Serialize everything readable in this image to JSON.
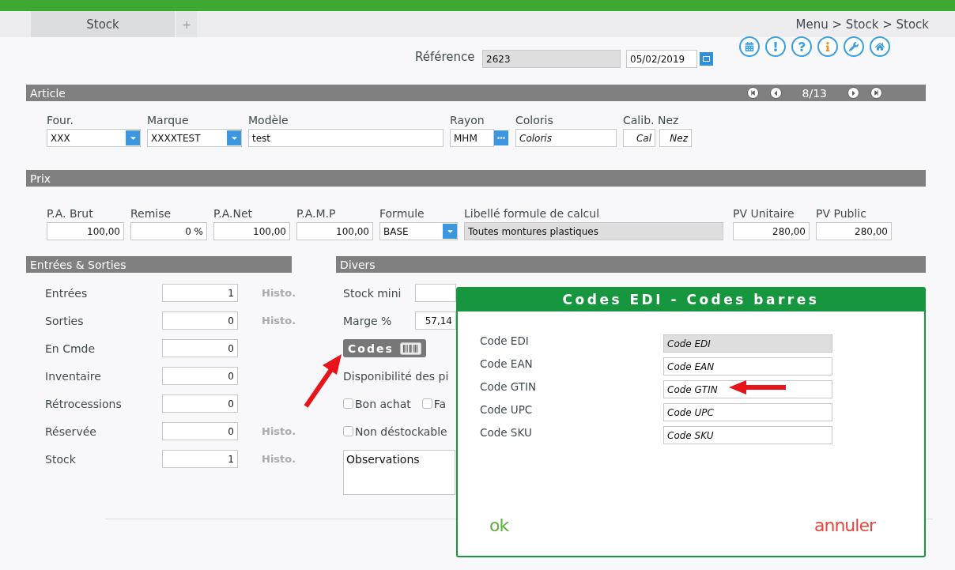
{
  "tabs": [
    {
      "label": "Stock",
      "selected": true
    },
    {
      "label": "+",
      "selected": false
    }
  ],
  "breadcrumb": "Menu > Stock > Stock",
  "reference": {
    "label": "Référence",
    "value": "2623",
    "date": "05/02/2019"
  },
  "toolbar_icons": [
    {
      "kind": "calendar"
    },
    {
      "kind": "alert"
    },
    {
      "kind": "help"
    },
    {
      "kind": "info"
    },
    {
      "kind": "tools"
    },
    {
      "kind": "home"
    }
  ],
  "article": {
    "title": "Article",
    "pager": "8/13",
    "fields": [
      {
        "kind": "select",
        "label": "Four.",
        "value": "XXX"
      },
      {
        "kind": "select",
        "label": "Marque",
        "value": "XXXXTEST"
      },
      {
        "kind": "text",
        "label": "Modèle",
        "value": "test"
      },
      {
        "kind": "lookup",
        "label": "Rayon",
        "value": "MHM"
      },
      {
        "kind": "text",
        "label": "Coloris",
        "placeholder": "Coloris"
      },
      {
        "kind": "pair",
        "label": "Calib. Nez",
        "placeholders": [
          "Cal",
          "Nez"
        ]
      }
    ]
  },
  "prix": {
    "title": "Prix",
    "fields": [
      {
        "kind": "number",
        "label": "P.A. Brut",
        "value": "100,00"
      },
      {
        "kind": "number",
        "label": "Remise",
        "value": "0 %"
      },
      {
        "kind": "number",
        "label": "P.A.Net",
        "value": "100,00"
      },
      {
        "kind": "number",
        "label": "P.A.M.P",
        "value": "100,00"
      },
      {
        "kind": "select",
        "label": "Formule",
        "value": "BASE"
      },
      {
        "kind": "readonly",
        "label": "Libellé formule de calcul",
        "value": "Toutes montures plastiques"
      },
      {
        "kind": "number",
        "label": "PV Unitaire",
        "value": "280,00"
      },
      {
        "kind": "number",
        "label": "PV Public",
        "value": "280,00"
      }
    ]
  },
  "entrees_sorties": {
    "title": "Entrées & Sorties",
    "rows": [
      {
        "label": "Entrées",
        "value": "1",
        "histo": "Histo."
      },
      {
        "label": "Sorties",
        "value": "0",
        "histo": "Histo."
      },
      {
        "label": "En Cmde",
        "value": "0"
      },
      {
        "label": "Inventaire",
        "value": "0"
      },
      {
        "label": "Rétrocessions",
        "value": "0"
      },
      {
        "label": "Réservée",
        "value": "0",
        "histo": "Histo."
      },
      {
        "label": "Stock",
        "value": "1",
        "histo": "Histo."
      }
    ]
  },
  "divers": {
    "title": "Divers",
    "stock_mini": {
      "label": "Stock mini"
    },
    "marge": {
      "label": "Marge %",
      "value": "57,14"
    },
    "codes_button": "Codes",
    "availability": "Disponibilité des pi",
    "checkbox_rows": [
      {
        "items": [
          {
            "label": "Bon achat",
            "checked": false
          },
          {
            "label": "Fa",
            "checked": false
          }
        ]
      },
      {
        "items": [
          {
            "label": "Non déstockable",
            "checked": false
          }
        ]
      }
    ],
    "observations": "Observations"
  },
  "dialog": {
    "title": "Codes EDI - Codes barres",
    "fields": [
      {
        "label": "Code EDI",
        "placeholder": "Code EDI",
        "disabled": true
      },
      {
        "label": "Code EAN",
        "placeholder": "Code EAN",
        "disabled": false
      },
      {
        "label": "Code GTIN",
        "placeholder": "Code GTIN",
        "disabled": false
      },
      {
        "label": "Code UPC",
        "placeholder": "Code UPC",
        "disabled": false
      },
      {
        "label": "Code SKU",
        "placeholder": "Code SKU",
        "disabled": false
      }
    ],
    "ok": "ok",
    "cancel": "annuler"
  }
}
